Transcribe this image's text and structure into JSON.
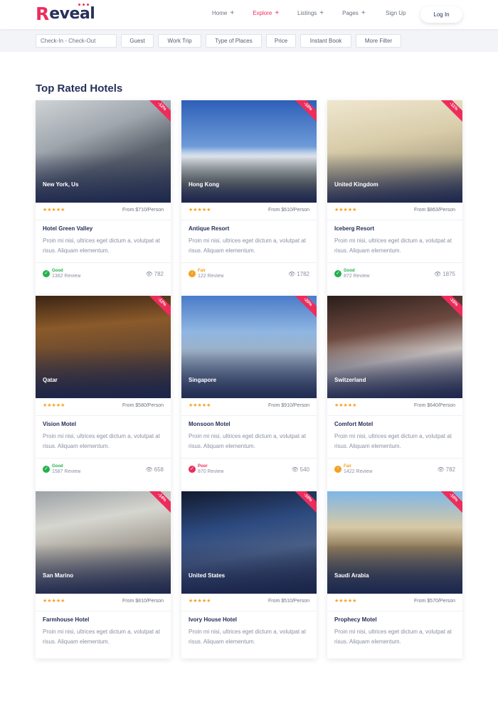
{
  "header": {
    "logo_first": "R",
    "logo_rest": "eveal",
    "nav": [
      {
        "label": "Home",
        "plus": "+"
      },
      {
        "label": "Explore",
        "plus": "+"
      },
      {
        "label": "Listings",
        "plus": "+"
      },
      {
        "label": "Pages",
        "plus": "+"
      }
    ],
    "signup": "Sign Up",
    "login": "Log In"
  },
  "filters": {
    "date_placeholder": "Check-In - Check-Out",
    "items": [
      "Guest",
      "Work Trip",
      "Type of Places",
      "Price",
      "Instant Book",
      "More Filter"
    ]
  },
  "section_title": "Top Rated Hotels",
  "colors": {
    "accent": "#ec2d5c",
    "navy": "#26305a",
    "good": "#22b14c",
    "fair": "#f4a020",
    "poor": "#ec2d5c"
  },
  "hotels": [
    {
      "location": "New York, Us",
      "discount": "-12%",
      "price": "From $710/Person",
      "name": "Hotel Green Valley",
      "desc": "Proin mi nisi, ultrices eget dictum a, volutpat at risus. Aliquam elementum.",
      "rating": "Good",
      "reviews": "1362 Review",
      "views": "782",
      "stars": "★★★★★"
    },
    {
      "location": "Hong Kong",
      "discount": "-10%",
      "price": "From $610/Person",
      "name": "Antique Resort",
      "desc": "Proin mi nisi, ultrices eget dictum a, volutpat at risus. Aliquam elementum.",
      "rating": "Fair",
      "reviews": "122 Review",
      "views": "1782",
      "stars": "★★★★★"
    },
    {
      "location": "United Kingdom",
      "discount": "-11%",
      "price": "From $863/Person",
      "name": "Iceberg Resort",
      "desc": "Proin mi nisi, ultrices eget dictum a, volutpat at risus. Aliquam elementum.",
      "rating": "Good",
      "reviews": "872 Review",
      "views": "1875",
      "stars": "★★★★★"
    },
    {
      "location": "Qatar",
      "discount": "-12%",
      "price": "From $580/Person",
      "name": "Vision Motel",
      "desc": "Proin mi nisi, ultrices eget dictum a, volutpat at risus. Aliquam elementum.",
      "rating": "Good",
      "reviews": "1587 Review",
      "views": "658",
      "stars": "★★★★★"
    },
    {
      "location": "Singapore",
      "discount": "-20%",
      "price": "From $910/Person",
      "name": "Monsoon Motel",
      "desc": "Proin mi nisi, ultrices eget dictum a, volutpat at risus. Aliquam elementum.",
      "rating": "Poor",
      "reviews": "870 Review",
      "views": "540",
      "stars": "★★★★★"
    },
    {
      "location": "Switzerland",
      "discount": "-15%",
      "price": "From $640/Person",
      "name": "Comfort Motel",
      "desc": "Proin mi nisi, ultrices eget dictum a, volutpat at risus. Aliquam elementum.",
      "rating": "Fair",
      "reviews": "1422 Review",
      "views": "782",
      "stars": "★★★★★"
    },
    {
      "location": "San Marino",
      "discount": "-14%",
      "price": "From $810/Person",
      "name": "Farmhouse Hotel",
      "desc": "Proin mi nisi, ultrices eget dictum a, volutpat at risus. Aliquam elementum.",
      "rating": "",
      "reviews": "",
      "views": "",
      "stars": "★★★★★"
    },
    {
      "location": "United States",
      "discount": "-10%",
      "price": "From $510/Person",
      "name": "Ivory House Hotel",
      "desc": "Proin mi nisi, ultrices eget dictum a, volutpat at risus. Aliquam elementum.",
      "rating": "",
      "reviews": "",
      "views": "",
      "stars": "★★★★★"
    },
    {
      "location": "Saudi Arabia",
      "discount": "-10%",
      "price": "From $570/Person",
      "name": "Prophecy Motel",
      "desc": "Proin mi nisi, ultrices eget dictum a, volutpat at risus. Aliquam elementum.",
      "rating": "",
      "reviews": "",
      "views": "",
      "stars": "★★★★★"
    }
  ]
}
